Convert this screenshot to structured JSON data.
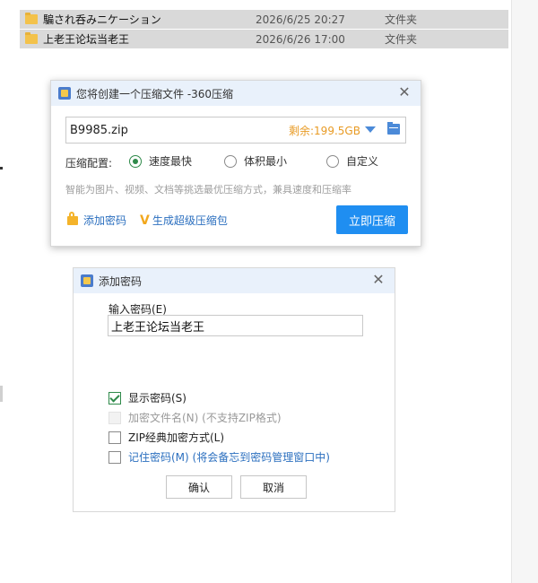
{
  "file_list": [
    {
      "name": "騙され呑みニケーション",
      "date": "2026/6/25 20:27",
      "type": "文件夹"
    },
    {
      "name": "上老王论坛当老王",
      "date": "2026/6/26 17:00",
      "type": "文件夹"
    }
  ],
  "compress_dialog": {
    "title": "您将创建一个压缩文件 -360压缩",
    "filename": "B9985.zip",
    "free_space": "剩余:199.5GB",
    "config_label": "压缩配置:",
    "options": [
      "速度最快",
      "体积最小",
      "自定义"
    ],
    "selected_option": "速度最快",
    "hint": "智能为图片、视频、文档等挑选最优压缩方式，兼具速度和压缩率",
    "add_password_link": "添加密码",
    "super_package_link": "生成超级压缩包",
    "compress_button": "立即压缩",
    "accent_color": "#1f8ef1"
  },
  "password_dialog": {
    "title": "添加密码",
    "input_label": "输入密码(E)",
    "password_value": "上老王论坛当老王",
    "checkboxes": [
      {
        "label": "显示密码(S)",
        "checked": true,
        "enabled": true
      },
      {
        "label": "加密文件名(N) (不支持ZIP格式)",
        "checked": false,
        "enabled": false
      },
      {
        "label": "ZIP经典加密方式(L)",
        "checked": false,
        "enabled": true
      },
      {
        "label": "记住密码(M) (将会备忘到密码管理窗口中)",
        "checked": false,
        "enabled": true
      }
    ],
    "ok_button": "确认",
    "cancel_button": "取消"
  },
  "icons": {
    "folder": "folder-icon",
    "app": "360zip-app-icon",
    "close": "close-icon",
    "lock": "lock-icon",
    "vip": "vip-v-icon",
    "browse": "browse-folder-icon",
    "dropdown": "chevron-down-icon"
  }
}
